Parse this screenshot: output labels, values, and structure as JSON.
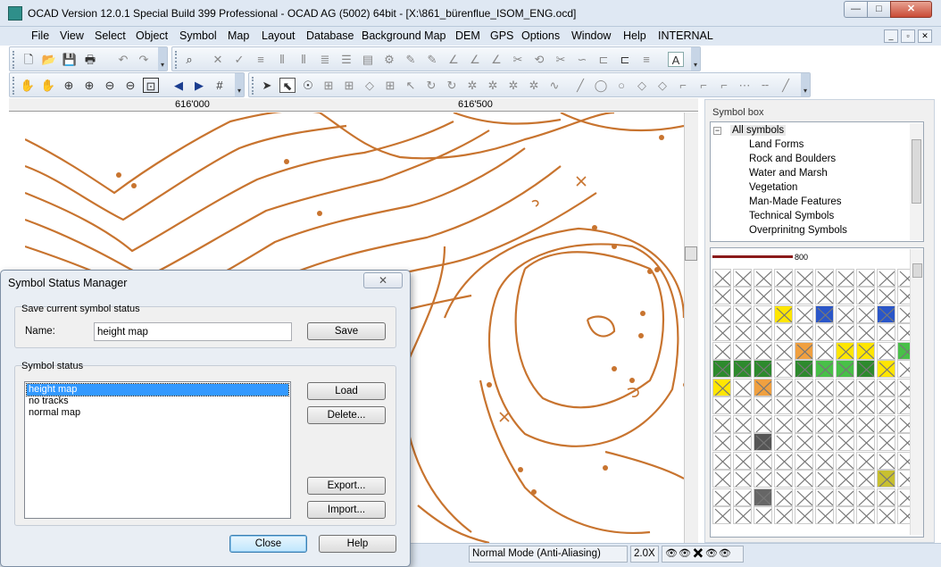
{
  "window": {
    "title": "OCAD Version 12.0.1  Special Build 399  Professional - OCAD AG (5002) 64bit - [X:\\861_bürenflue_ISOM_ENG.ocd]",
    "min_glyph": "—",
    "max_glyph": "□",
    "close_glyph": "✕"
  },
  "menu": {
    "items": [
      "File",
      "View",
      "Select",
      "Object",
      "Symbol",
      "Map",
      "Layout",
      "Database",
      "Background Map",
      "DEM",
      "GPS",
      "Options",
      "Window",
      "Help",
      "INTERNAL"
    ],
    "mdi": [
      "_",
      "▫",
      "✕"
    ]
  },
  "ruler": {
    "labels": [
      "616'000",
      "616'500"
    ]
  },
  "symbol_box": {
    "title": "Symbol box",
    "tree": {
      "root": "All symbols",
      "children": [
        "Land Forms",
        "Rock and Boulders",
        "Water and Marsh",
        "Vegetation",
        "Man-Made Features",
        "Technical Symbols",
        "Overprinitng Symbols"
      ]
    },
    "grid_label": "800"
  },
  "dialog": {
    "title": "Symbol Status Manager",
    "close_glyph": "✕",
    "save_group": {
      "label": "Save current symbol status",
      "name_label": "Name:",
      "name_value": "height map",
      "save_button": "Save"
    },
    "status_group": {
      "label": "Symbol status",
      "items": [
        "height map",
        "no tracks",
        "normal map"
      ],
      "selected_index": 0,
      "load_button": "Load",
      "delete_button": "Delete...",
      "export_button": "Export...",
      "import_button": "Import..."
    },
    "close_button": "Close",
    "help_button": "Help"
  },
  "status_bar": {
    "mode": "Normal Mode (Anti-Aliasing)",
    "zoom": "2.0X"
  },
  "colors": {
    "contour": "#c8742f",
    "selection": "#3399ff",
    "chrome": "#dfe8f3"
  }
}
